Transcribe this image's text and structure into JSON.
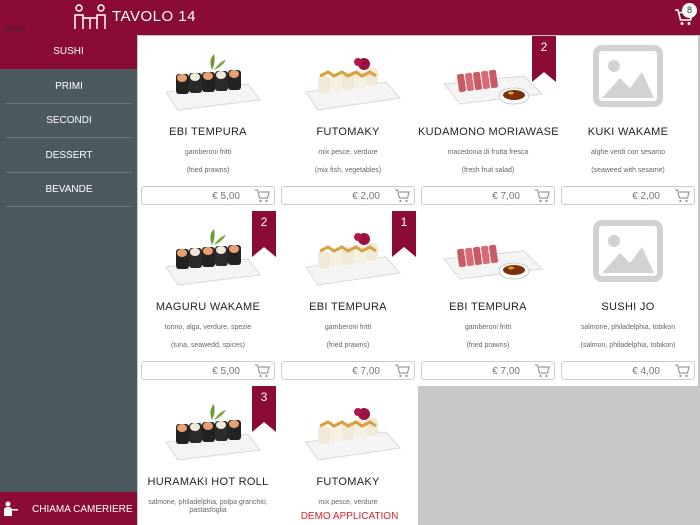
{
  "header": {
    "title": "TAVOLO 14",
    "cart_count": "8",
    "brand_color": "#8a0b35"
  },
  "category_caption": "SUSHI",
  "sidebar": {
    "items": [
      {
        "label": "SUSHI",
        "active": true
      },
      {
        "label": "PRIMI",
        "active": false
      },
      {
        "label": "SECONDI",
        "active": false
      },
      {
        "label": "DESSERT",
        "active": false
      },
      {
        "label": "BEVANDE",
        "active": false
      }
    ],
    "call_waiter": "CHIAMA CAMERIERE"
  },
  "products": [
    {
      "name": "EBI TEMPURA",
      "desc": "gamberoni fritti",
      "desc_en": "(fried prawns)",
      "price": "€ 5,00",
      "image": "maki-roll-plate",
      "badge": ""
    },
    {
      "name": "FUTOMAKY",
      "desc": "mix pesce, verdure",
      "desc_en": "(mix fish, vegetables)",
      "price": "€ 2,00",
      "image": "uramaki-plate",
      "badge": ""
    },
    {
      "name": "KUDAMONO MORIAWASE",
      "desc": "macedonia di frutta fresca",
      "desc_en": "(fresh fruit salad)",
      "price": "€ 7,00",
      "image": "tataki-plate",
      "badge": "2"
    },
    {
      "name": "KUKI WAKAME",
      "desc": "alghe verdi con sesamo",
      "desc_en": "(seaweed with sesame)",
      "price": "€ 2,00",
      "image": "placeholder-image",
      "badge": ""
    },
    {
      "name": "MAGURU WAKAME",
      "desc": "tonno, alga, verdure, spezie",
      "desc_en": "(tuna, seawedd, spices)",
      "price": "€ 5,00",
      "image": "maki-roll-plate",
      "badge": "2"
    },
    {
      "name": "EBI TEMPURA",
      "desc": "gamberoni fritti",
      "desc_en": "(fried prawns)",
      "price": "€ 7,00",
      "image": "uramaki-plate",
      "badge": "1"
    },
    {
      "name": "EBI TEMPURA",
      "desc": "gamberoni fritti",
      "desc_en": "(fried prawns)",
      "price": "€ 7,00",
      "image": "tataki-plate",
      "badge": ""
    },
    {
      "name": "SUSHI JO",
      "desc": "salmone, philadelphia, tobikon",
      "desc_en": "(salmon, philadelphia, tobikon)",
      "price": "€ 4,00",
      "image": "placeholder-image",
      "badge": ""
    },
    {
      "name": "HURAMAKI HOT ROLL",
      "desc": "salmone, philadelphia, polpa granchio, pastasfoglia",
      "desc_en": "",
      "price": "",
      "image": "maki-roll-plate",
      "badge": "3"
    },
    {
      "name": "FUTOMAKY",
      "desc": "mix pesce, verdure",
      "desc_en": "",
      "price": "",
      "image": "uramaki-plate",
      "badge": ""
    }
  ],
  "footer": {
    "demo_label": "DEMO APPLICATION",
    "demo_color": "#e0202a"
  }
}
